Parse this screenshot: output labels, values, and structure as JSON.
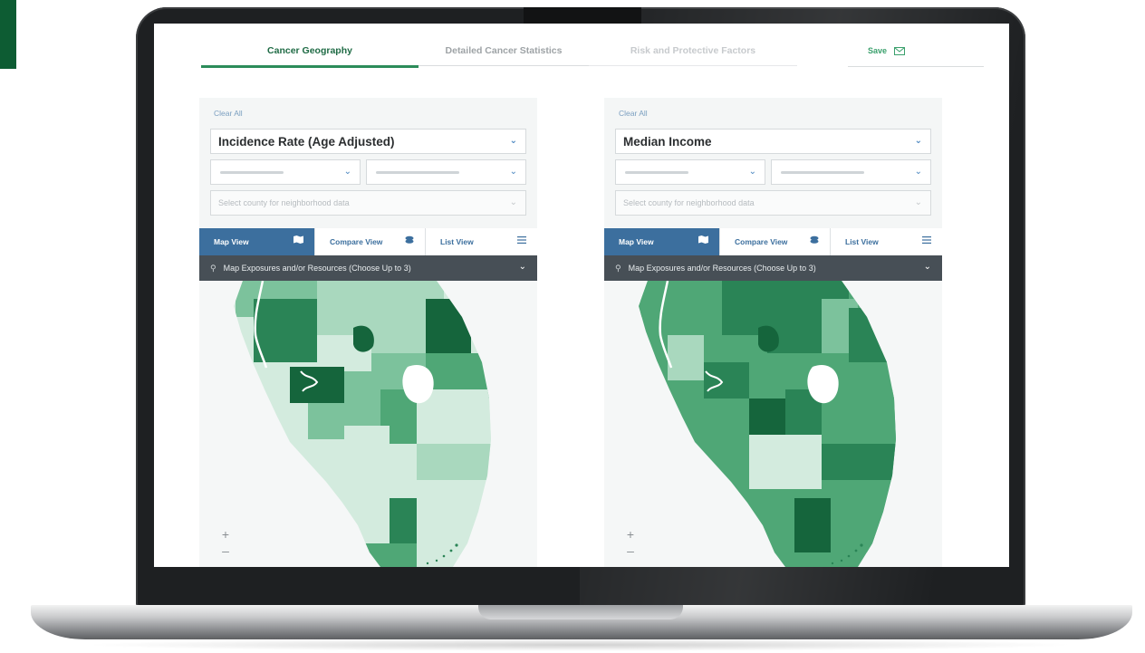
{
  "tabs": {
    "cancer_geography": "Cancer Geography",
    "detailed_stats": "Detailed Cancer Statistics",
    "risk_factors": "Risk and Protective Factors",
    "save": "Save"
  },
  "left_panel": {
    "clear_all": "Clear All",
    "metric": "Incidence Rate (Age Adjusted)",
    "county_placeholder": "Select county for neighborhood data",
    "views": {
      "map": "Map View",
      "compare": "Compare View",
      "list": "List View"
    },
    "exposures": "Map Exposures and/or Resources (Choose Up to 3)",
    "zoom_in": "+",
    "zoom_out": "–"
  },
  "right_panel": {
    "clear_all": "Clear All",
    "metric": "Median Income",
    "county_placeholder": "Select county for neighborhood data",
    "views": {
      "map": "Map View",
      "compare": "Compare View",
      "list": "List View"
    },
    "exposures": "Map Exposures and/or Resources (Choose Up to 3)",
    "zoom_in": "+",
    "zoom_out": "–"
  },
  "colors": {
    "brand_green": "#2c8c5a",
    "map_view_blue": "#3c6f9e",
    "exposure_bar": "#474f56",
    "choropleth_scale": [
      "#d3ebde",
      "#a9d8be",
      "#7cc29c",
      "#4fa776",
      "#2a8456",
      "#15653c"
    ]
  }
}
